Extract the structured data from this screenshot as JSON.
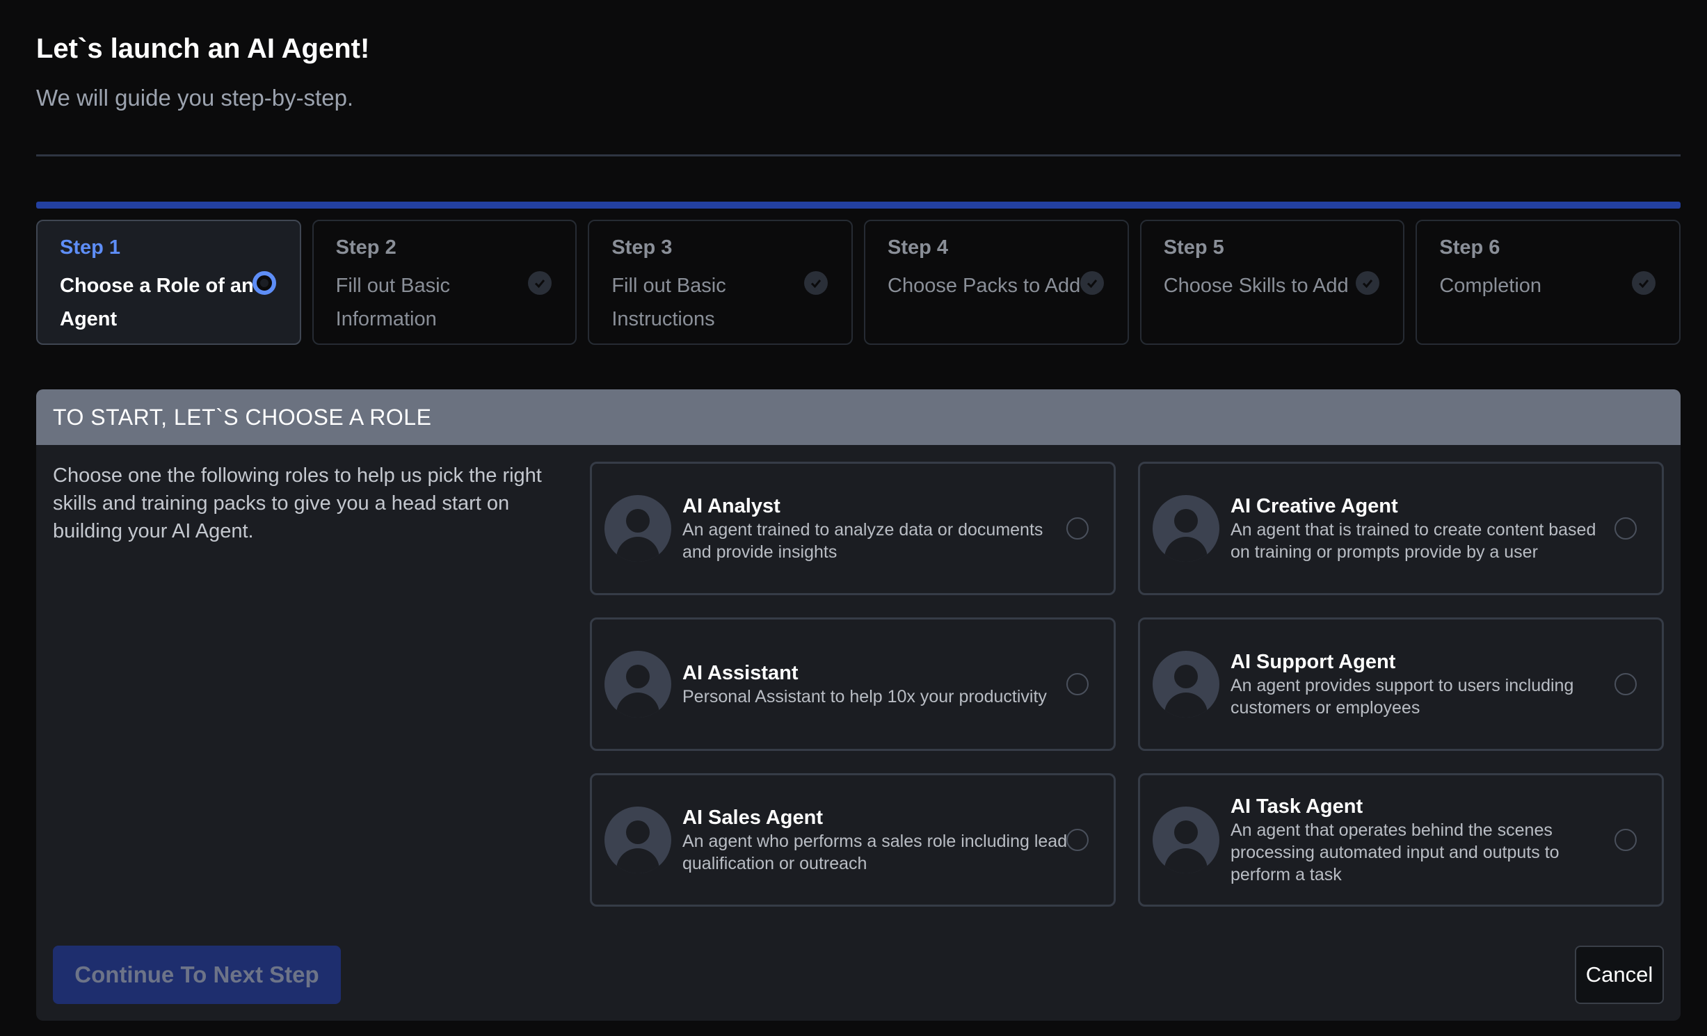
{
  "header": {
    "title": "Let`s launch an AI Agent!",
    "subtitle": "We will guide you step-by-step."
  },
  "steps": [
    {
      "number": "Step 1",
      "label": "Choose a Role of an Agent",
      "status": "current"
    },
    {
      "number": "Step 2",
      "label": "Fill out Basic Information",
      "status": "pending"
    },
    {
      "number": "Step 3",
      "label": "Fill out Basic Instructions",
      "status": "pending"
    },
    {
      "number": "Step 4",
      "label": "Choose Packs to Add",
      "status": "pending"
    },
    {
      "number": "Step 5",
      "label": "Choose Skills to Add",
      "status": "pending"
    },
    {
      "number": "Step 6",
      "label": "Completion",
      "status": "pending"
    }
  ],
  "panel": {
    "heading": "TO START, LET`S CHOOSE A ROLE",
    "intro": "Choose one the following roles to help us pick the right skills and training packs to give you a head start on building your AI Agent."
  },
  "roles": [
    {
      "title": "AI Analyst",
      "description": "An agent trained to analyze data or documents and provide insights",
      "selected": false
    },
    {
      "title": "AI Creative Agent",
      "description": "An agent that is trained to create content based on training or prompts provide by a user",
      "selected": false
    },
    {
      "title": "AI Assistant",
      "description": "Personal Assistant to help 10x your productivity",
      "selected": false
    },
    {
      "title": "AI Support Agent",
      "description": "An agent provides support to users including customers or employees",
      "selected": false
    },
    {
      "title": "AI Sales Agent",
      "description": "An agent who performs a sales role including lead qualification or outreach",
      "selected": false
    },
    {
      "title": "AI Task Agent",
      "description": "An agent that operates behind the scenes processing automated input and outputs to perform a task",
      "selected": false
    }
  ],
  "actions": {
    "continue_label": "Continue To Next Step",
    "cancel_label": "Cancel"
  },
  "colors": {
    "accent": "#5e8ef7",
    "progress": "#2340a0",
    "continue_bg": "#1e2e6e",
    "panel_header": "#6b7280"
  },
  "icons": {
    "step_current": "radio-selected-icon",
    "step_pending": "check-circle-icon",
    "role_avatar": "user-avatar-icon",
    "role_select": "radio-icon"
  }
}
